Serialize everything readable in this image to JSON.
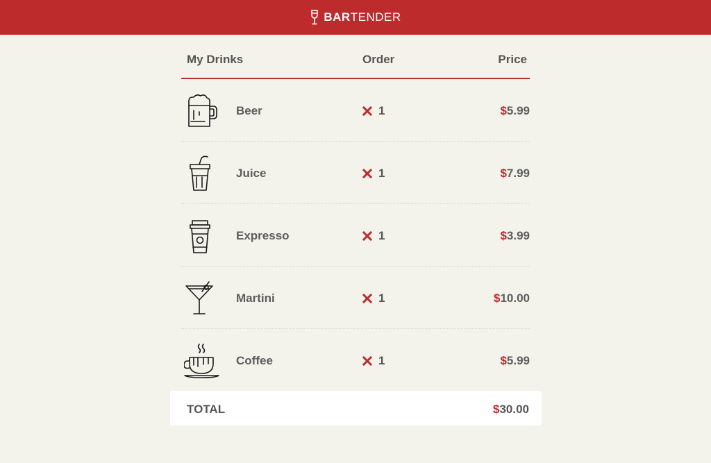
{
  "brand": {
    "bold": "BAR",
    "regular": "TENDER",
    "icon": "wine-glass-icon"
  },
  "colors": {
    "accent": "#bd2b2d",
    "background": "#f3f3ec",
    "text": "#555555"
  },
  "table": {
    "headers": {
      "drinks": "My Drinks",
      "order": "Order",
      "price": "Price"
    },
    "currency": "$",
    "rows": [
      {
        "name": "Beer",
        "icon": "beer-mug-icon",
        "quantity": "1",
        "price": "5.99"
      },
      {
        "name": "Juice",
        "icon": "juice-cup-icon",
        "quantity": "1",
        "price": "7.99"
      },
      {
        "name": "Expresso",
        "icon": "coffee-cup-icon",
        "quantity": "1",
        "price": "3.99"
      },
      {
        "name": "Martini",
        "icon": "martini-glass-icon",
        "quantity": "1",
        "price": "10.00"
      },
      {
        "name": "Coffee",
        "icon": "hot-coffee-icon",
        "quantity": "1",
        "price": "5.99"
      }
    ]
  },
  "total": {
    "label": "TOTAL",
    "currency": "$",
    "amount": "30.00"
  }
}
